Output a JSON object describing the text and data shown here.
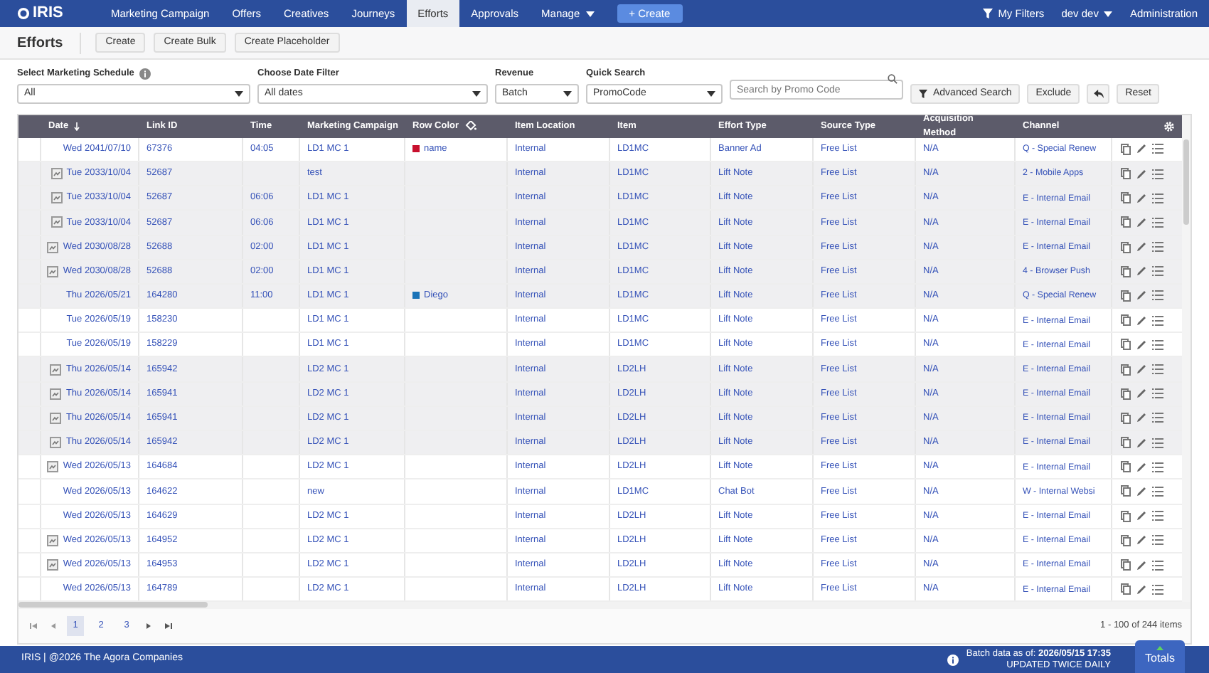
{
  "nav": {
    "logo": "IRIS",
    "items": [
      {
        "label": "Marketing Campaign",
        "selected": false
      },
      {
        "label": "Offers",
        "selected": false
      },
      {
        "label": "Creatives",
        "selected": false
      },
      {
        "label": "Journeys",
        "selected": false
      },
      {
        "label": "Efforts",
        "selected": true
      },
      {
        "label": "Approvals",
        "selected": false
      },
      {
        "label": "Manage",
        "selected": false,
        "dropdown": true
      }
    ],
    "create": "+ Create",
    "my_filters": "My Filters",
    "user": "dev dev",
    "admin": "Administration"
  },
  "page": {
    "title": "Efforts",
    "buttons": [
      "Create",
      "Create Bulk",
      "Create Placeholder"
    ]
  },
  "filters": {
    "schedule": {
      "label": "Select Marketing Schedule",
      "value": "All"
    },
    "date_filter": {
      "label": "Choose Date Filter",
      "value": "All dates"
    },
    "revenue": {
      "label": "Revenue",
      "value": "Batch"
    },
    "quick_search": {
      "label": "Quick Search",
      "value": "PromoCode",
      "placeholder": "Search by Promo Code"
    },
    "advanced_search": "Advanced Search",
    "exclude": "Exclude",
    "reset": "Reset"
  },
  "table": {
    "columns": [
      "Date",
      "Link ID",
      "Time",
      "Marketing Campaign",
      "Row Color",
      "Item Location",
      "Item",
      "Effort Type",
      "Source Type",
      "Acquisition Method",
      "Channel"
    ],
    "rows": [
      {
        "date": "Wed 2041/07/10",
        "link_id": "67376",
        "time": "04:05",
        "campaign": "LD1 MC 1",
        "row_color": {
          "label": "name",
          "color": "#c8102e"
        },
        "location": "Internal",
        "item": "LD1MC",
        "effort_type": "Banner Ad",
        "source_type": "Free List",
        "acquisition": "N/A",
        "channel": "Q - Special Renew",
        "shaded": false,
        "attachment": false
      },
      {
        "date": "Tue 2033/10/04",
        "link_id": "52687",
        "time": "",
        "campaign": "test",
        "location": "Internal",
        "item": "LD1MC",
        "effort_type": "Lift Note",
        "source_type": "Free List",
        "acquisition": "N/A",
        "channel": "2 - Mobile Apps",
        "shaded": true,
        "attachment": true
      },
      {
        "date": "Tue 2033/10/04",
        "link_id": "52687",
        "time": "06:06",
        "campaign": "LD1 MC 1",
        "location": "Internal",
        "item": "LD1MC",
        "effort_type": "Lift Note",
        "source_type": "Free List",
        "acquisition": "N/A",
        "channel": "E - Internal Email",
        "shaded": true,
        "attachment": true
      },
      {
        "date": "Tue 2033/10/04",
        "link_id": "52687",
        "time": "06:06",
        "campaign": "LD1 MC 1",
        "location": "Internal",
        "item": "LD1MC",
        "effort_type": "Lift Note",
        "source_type": "Free List",
        "acquisition": "N/A",
        "channel": "E - Internal Email",
        "shaded": true,
        "attachment": true
      },
      {
        "date": "Wed 2030/08/28",
        "link_id": "52688",
        "time": "02:00",
        "campaign": "LD1 MC 1",
        "location": "Internal",
        "item": "LD1MC",
        "effort_type": "Lift Note",
        "source_type": "Free List",
        "acquisition": "N/A",
        "channel": "E - Internal Email",
        "shaded": true,
        "attachment": true
      },
      {
        "date": "Wed 2030/08/28",
        "link_id": "52688",
        "time": "02:00",
        "campaign": "LD1 MC 1",
        "location": "Internal",
        "item": "LD1MC",
        "effort_type": "Lift Note",
        "source_type": "Free List",
        "acquisition": "N/A",
        "channel": "4 - Browser Push",
        "shaded": true,
        "attachment": true
      },
      {
        "date": "Thu 2026/05/21",
        "link_id": "164280",
        "time": "11:00",
        "campaign": "LD1 MC 1",
        "row_color": {
          "label": "Diego",
          "color": "#1a73b8"
        },
        "location": "Internal",
        "item": "LD1MC",
        "effort_type": "Lift Note",
        "source_type": "Free List",
        "acquisition": "N/A",
        "channel": "Q - Special Renew",
        "shaded": true,
        "attachment": false
      },
      {
        "date": "Tue 2026/05/19",
        "link_id": "158230",
        "time": "",
        "campaign": "LD1 MC 1",
        "location": "Internal",
        "item": "LD1MC",
        "effort_type": "Lift Note",
        "source_type": "Free List",
        "acquisition": "N/A",
        "channel": "E - Internal Email",
        "shaded": false,
        "attachment": false
      },
      {
        "date": "Tue 2026/05/19",
        "link_id": "158229",
        "time": "",
        "campaign": "LD1 MC 1",
        "location": "Internal",
        "item": "LD1MC",
        "effort_type": "Lift Note",
        "source_type": "Free List",
        "acquisition": "N/A",
        "channel": "E - Internal Email",
        "shaded": false,
        "attachment": false
      },
      {
        "date": "Thu 2026/05/14",
        "link_id": "165942",
        "time": "",
        "campaign": "LD2 MC 1",
        "location": "Internal",
        "item": "LD2LH",
        "effort_type": "Lift Note",
        "source_type": "Free List",
        "acquisition": "N/A",
        "channel": "E - Internal Email",
        "shaded": true,
        "attachment": true
      },
      {
        "date": "Thu 2026/05/14",
        "link_id": "165941",
        "time": "",
        "campaign": "LD2 MC 1",
        "location": "Internal",
        "item": "LD2LH",
        "effort_type": "Lift Note",
        "source_type": "Free List",
        "acquisition": "N/A",
        "channel": "E - Internal Email",
        "shaded": true,
        "attachment": true
      },
      {
        "date": "Thu 2026/05/14",
        "link_id": "165941",
        "time": "",
        "campaign": "LD2 MC 1",
        "location": "Internal",
        "item": "LD2LH",
        "effort_type": "Lift Note",
        "source_type": "Free List",
        "acquisition": "N/A",
        "channel": "E - Internal Email",
        "shaded": true,
        "attachment": true
      },
      {
        "date": "Thu 2026/05/14",
        "link_id": "165942",
        "time": "",
        "campaign": "LD2 MC 1",
        "location": "Internal",
        "item": "LD2LH",
        "effort_type": "Lift Note",
        "source_type": "Free List",
        "acquisition": "N/A",
        "channel": "E - Internal Email",
        "shaded": true,
        "attachment": true
      },
      {
        "date": "Wed 2026/05/13",
        "link_id": "164684",
        "time": "",
        "campaign": "LD2 MC 1",
        "location": "Internal",
        "item": "LD2LH",
        "effort_type": "Lift Note",
        "source_type": "Free List",
        "acquisition": "N/A",
        "channel": "E - Internal Email",
        "shaded": false,
        "attachment": true
      },
      {
        "date": "Wed 2026/05/13",
        "link_id": "164622",
        "time": "",
        "campaign": "new",
        "location": "Internal",
        "item": "LD1MC",
        "effort_type": "Chat Bot",
        "source_type": "Free List",
        "acquisition": "N/A",
        "channel": "W - Internal Websi",
        "shaded": false,
        "attachment": false
      },
      {
        "date": "Wed 2026/05/13",
        "link_id": "164629",
        "time": "",
        "campaign": "LD2 MC 1",
        "location": "Internal",
        "item": "LD2LH",
        "effort_type": "Lift Note",
        "source_type": "Free List",
        "acquisition": "N/A",
        "channel": "E - Internal Email",
        "shaded": false,
        "attachment": false
      },
      {
        "date": "Wed 2026/05/13",
        "link_id": "164952",
        "time": "",
        "campaign": "LD2 MC 1",
        "location": "Internal",
        "item": "LD2LH",
        "effort_type": "Lift Note",
        "source_type": "Free List",
        "acquisition": "N/A",
        "channel": "E - Internal Email",
        "shaded": false,
        "attachment": true
      },
      {
        "date": "Wed 2026/05/13",
        "link_id": "164953",
        "time": "",
        "campaign": "LD2 MC 1",
        "location": "Internal",
        "item": "LD2LH",
        "effort_type": "Lift Note",
        "source_type": "Free List",
        "acquisition": "N/A",
        "channel": "E - Internal Email",
        "shaded": false,
        "attachment": true
      },
      {
        "date": "Wed 2026/05/13",
        "link_id": "164789",
        "time": "",
        "campaign": "LD2 MC 1",
        "location": "Internal",
        "item": "LD2LH",
        "effort_type": "Lift Note",
        "source_type": "Free List",
        "acquisition": "N/A",
        "channel": "E - Internal Email",
        "shaded": false,
        "attachment": false
      }
    ]
  },
  "pagination": {
    "pages": [
      {
        "label": "1",
        "selected": true
      },
      {
        "label": "2",
        "selected": false
      },
      {
        "label": "3",
        "selected": false
      }
    ],
    "summary": "1 - 100 of 244 items"
  },
  "footer": {
    "copyright": "IRIS | @2026 The Agora Companies",
    "batch_label": "Batch data as of:",
    "batch_date": "2026/05/15 17:35",
    "update_note": "UPDATED TWICE DAILY",
    "totals": "Totals"
  }
}
